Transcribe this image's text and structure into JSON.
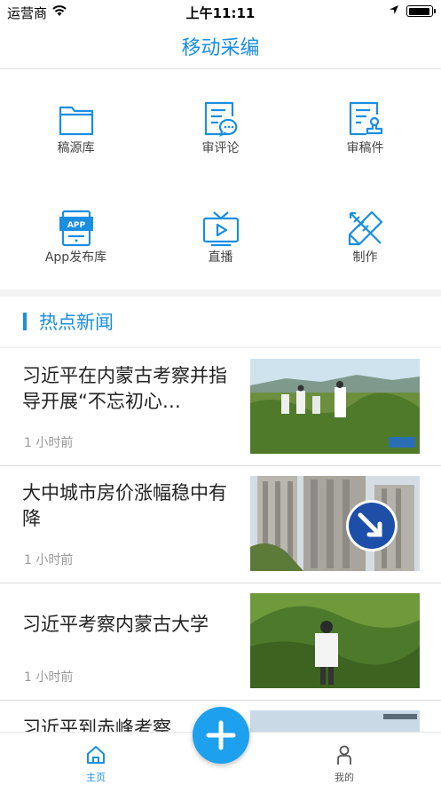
{
  "status_bar": {
    "carrier": "运营商",
    "time": "上午11:11"
  },
  "navbar": {
    "title": "移动采编"
  },
  "grid": {
    "items": [
      {
        "label": "稿源库",
        "icon": "folder-icon"
      },
      {
        "label": "审评论",
        "icon": "comment-review-icon"
      },
      {
        "label": "审稿件",
        "icon": "document-stamp-icon"
      },
      {
        "label": "App发布库",
        "icon": "app-publish-icon"
      },
      {
        "label": "直播",
        "icon": "tv-live-icon"
      },
      {
        "label": "制作",
        "icon": "ruler-pencil-icon"
      }
    ]
  },
  "section": {
    "title": "热点新闻"
  },
  "news": [
    {
      "headline": "习近平在内蒙古考察并指导开展“不忘初心…",
      "time": "1 小时前"
    },
    {
      "headline": "大中城市房价涨幅稳中有降",
      "time": "1 小时前"
    },
    {
      "headline": "习近平考察内蒙古大学",
      "time": "1 小时前"
    },
    {
      "headline": "习近平到赤峰考察",
      "time": ""
    }
  ],
  "tabbar": {
    "home_label": "主页",
    "mine_label": "我的"
  },
  "colors": {
    "accent": "#1a8ee1",
    "fab": "#1da1ee"
  }
}
